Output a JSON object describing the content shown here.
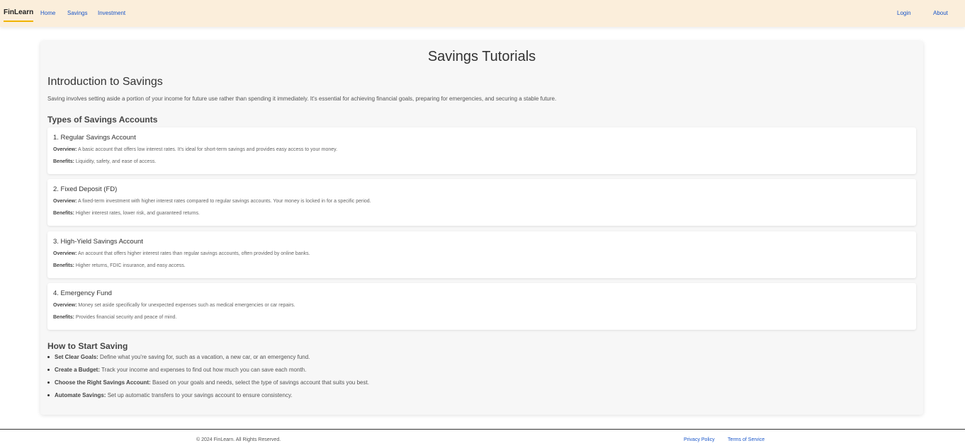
{
  "nav": {
    "brand": "FinLearn",
    "links": [
      "Home",
      "Savings",
      "Investment"
    ],
    "right_links": [
      "Login",
      "About"
    ]
  },
  "main": {
    "title": "Savings Tutorials",
    "intro_title": "Introduction to Savings",
    "intro_text": "Saving involves setting aside a portion of your income for future use rather than spending it immediately. It's essential for achieving financial goals, preparing for emergencies, and securing a stable future.",
    "types_title": "Types of Savings Accounts",
    "overview_label": "Overview:",
    "benefits_label": "Benefits:",
    "accounts": [
      {
        "title": "1. Regular Savings Account",
        "overview": "A basic account that offers low interest rates. It's ideal for short-term savings and provides easy access to your money.",
        "benefits": "Liquidity, safety, and ease of access."
      },
      {
        "title": "2. Fixed Deposit (FD)",
        "overview": "A fixed-term investment with higher interest rates compared to regular savings accounts. Your money is locked in for a specific period.",
        "benefits": "Higher interest rates, lower risk, and guaranteed returns."
      },
      {
        "title": "3. High-Yield Savings Account",
        "overview": "An account that offers higher interest rates than regular savings accounts, often provided by online banks.",
        "benefits": "Higher returns, FDIC insurance, and easy access."
      },
      {
        "title": "4. Emergency Fund",
        "overview": "Money set aside specifically for unexpected expenses such as medical emergencies or car repairs.",
        "benefits": "Provides financial security and peace of mind."
      }
    ],
    "start_title": "How to Start Saving",
    "steps": [
      {
        "label": "Set Clear Goals:",
        "text": "Define what you're saving for, such as a vacation, a new car, or an emergency fund."
      },
      {
        "label": "Create a Budget:",
        "text": "Track your income and expenses to find out how much you can save each month."
      },
      {
        "label": "Choose the Right Savings Account:",
        "text": "Based on your goals and needs, select the type of savings account that suits you best."
      },
      {
        "label": "Automate Savings:",
        "text": "Set up automatic transfers to your savings account to ensure consistency."
      }
    ]
  },
  "footer": {
    "copyright": "© 2024 FinLearn. All Rights Reserved.",
    "privacy": "Privacy Policy",
    "terms": "Terms of Service"
  },
  "colors": {
    "navbar_bg": "#fbeedb",
    "brand_underline": "#f0b400",
    "link": "#1a56c9"
  }
}
